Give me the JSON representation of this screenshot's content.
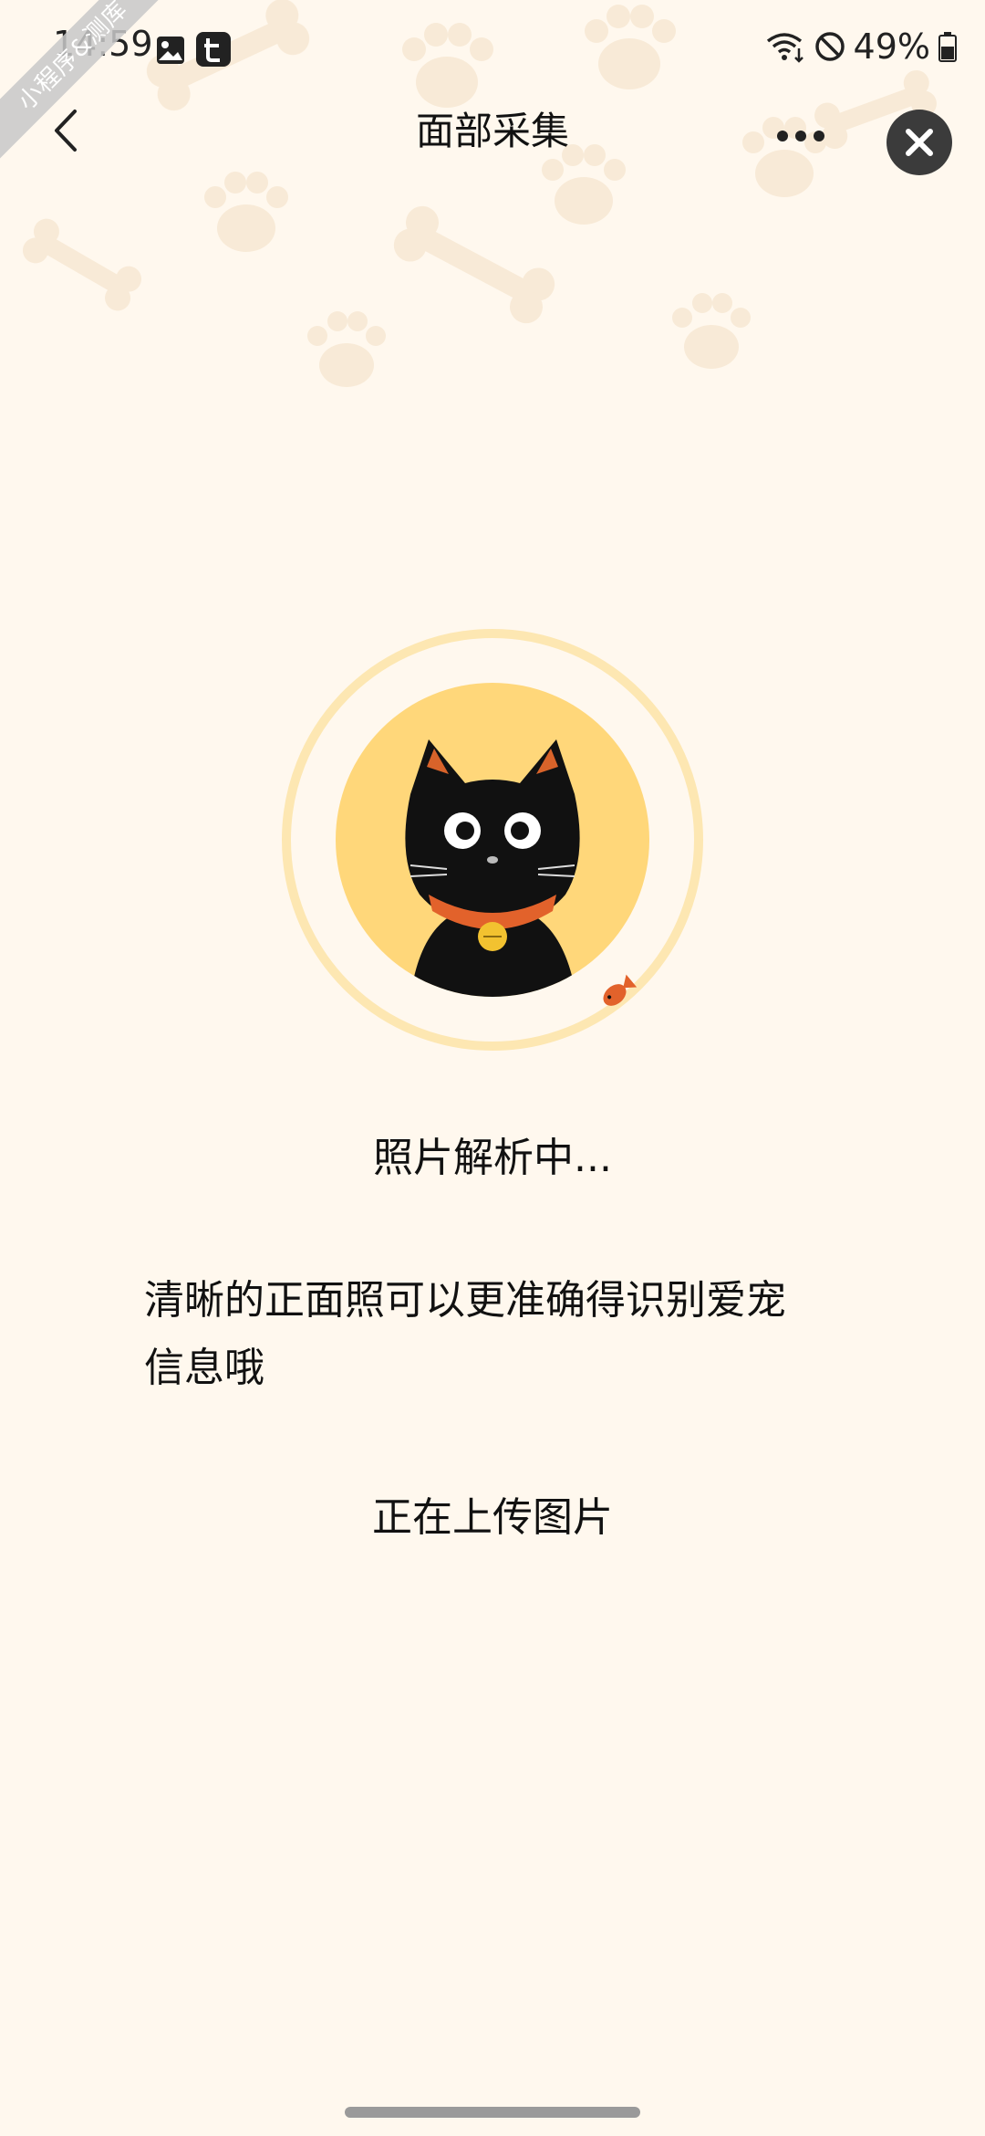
{
  "status_bar": {
    "time": "14:59",
    "battery_percent": "49%"
  },
  "watermark": {
    "text": "小程序&测库"
  },
  "nav": {
    "title": "面部采集"
  },
  "progress": {
    "status_text": "照片解析中...",
    "tip_line1": "清晰的正面照可以更准确得识别爱宠",
    "tip_line2": "信息哦",
    "uploading_text": "正在上传图片"
  },
  "colors": {
    "background": "#FFF8EE",
    "avatar_bg": "#FFD77A",
    "ring": "#FDE7B2",
    "collar": "#E2622B",
    "bell": "#F2C230",
    "close_button": "#3B3B3B"
  }
}
